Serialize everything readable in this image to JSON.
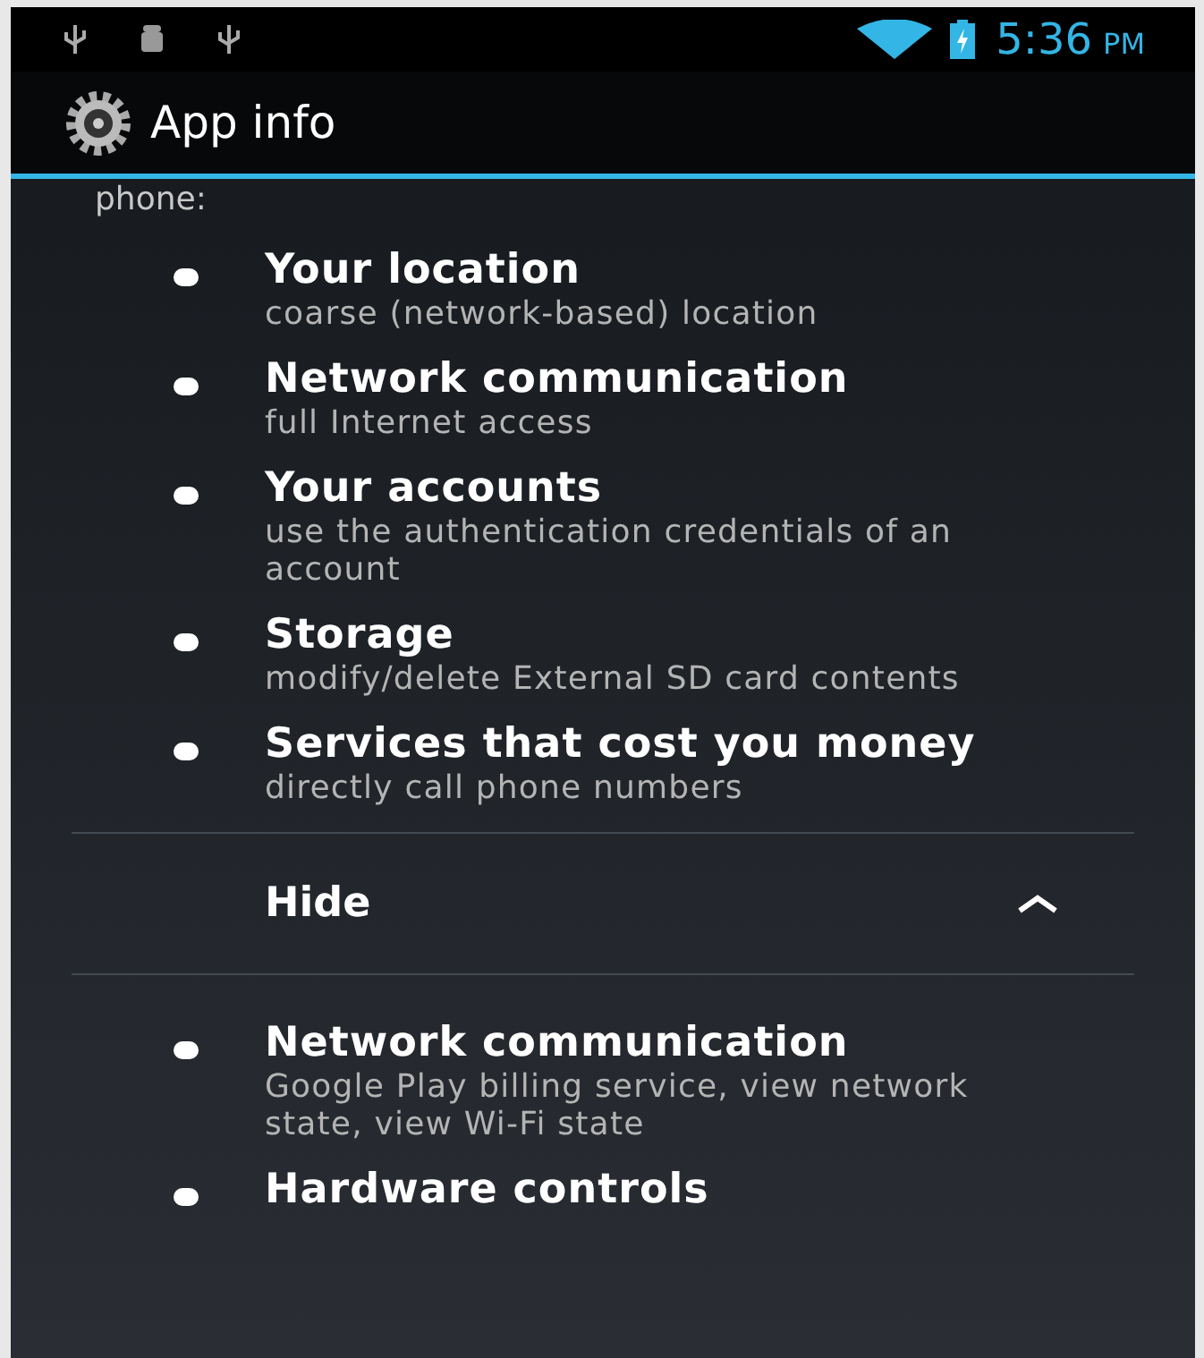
{
  "status_bar": {
    "time": "5:36",
    "ampm": "PM"
  },
  "action_bar": {
    "title": "App info"
  },
  "intro_tail": "phone:",
  "permissions": [
    {
      "title": "Your location",
      "detail": "coarse (network-based) location"
    },
    {
      "title": "Network communication",
      "detail": "full Internet access"
    },
    {
      "title": "Your accounts",
      "detail": "use the authentication credentials of an account"
    },
    {
      "title": "Storage",
      "detail": "modify/delete External SD card contents"
    },
    {
      "title": "Services that cost you money",
      "detail": "directly call phone numbers"
    }
  ],
  "toggle": {
    "label": "Hide",
    "expanded": true
  },
  "more_permissions": [
    {
      "title": "Network communication",
      "detail": "Google Play billing service, view network state, view Wi-Fi state"
    },
    {
      "title": "Hardware controls"
    }
  ]
}
